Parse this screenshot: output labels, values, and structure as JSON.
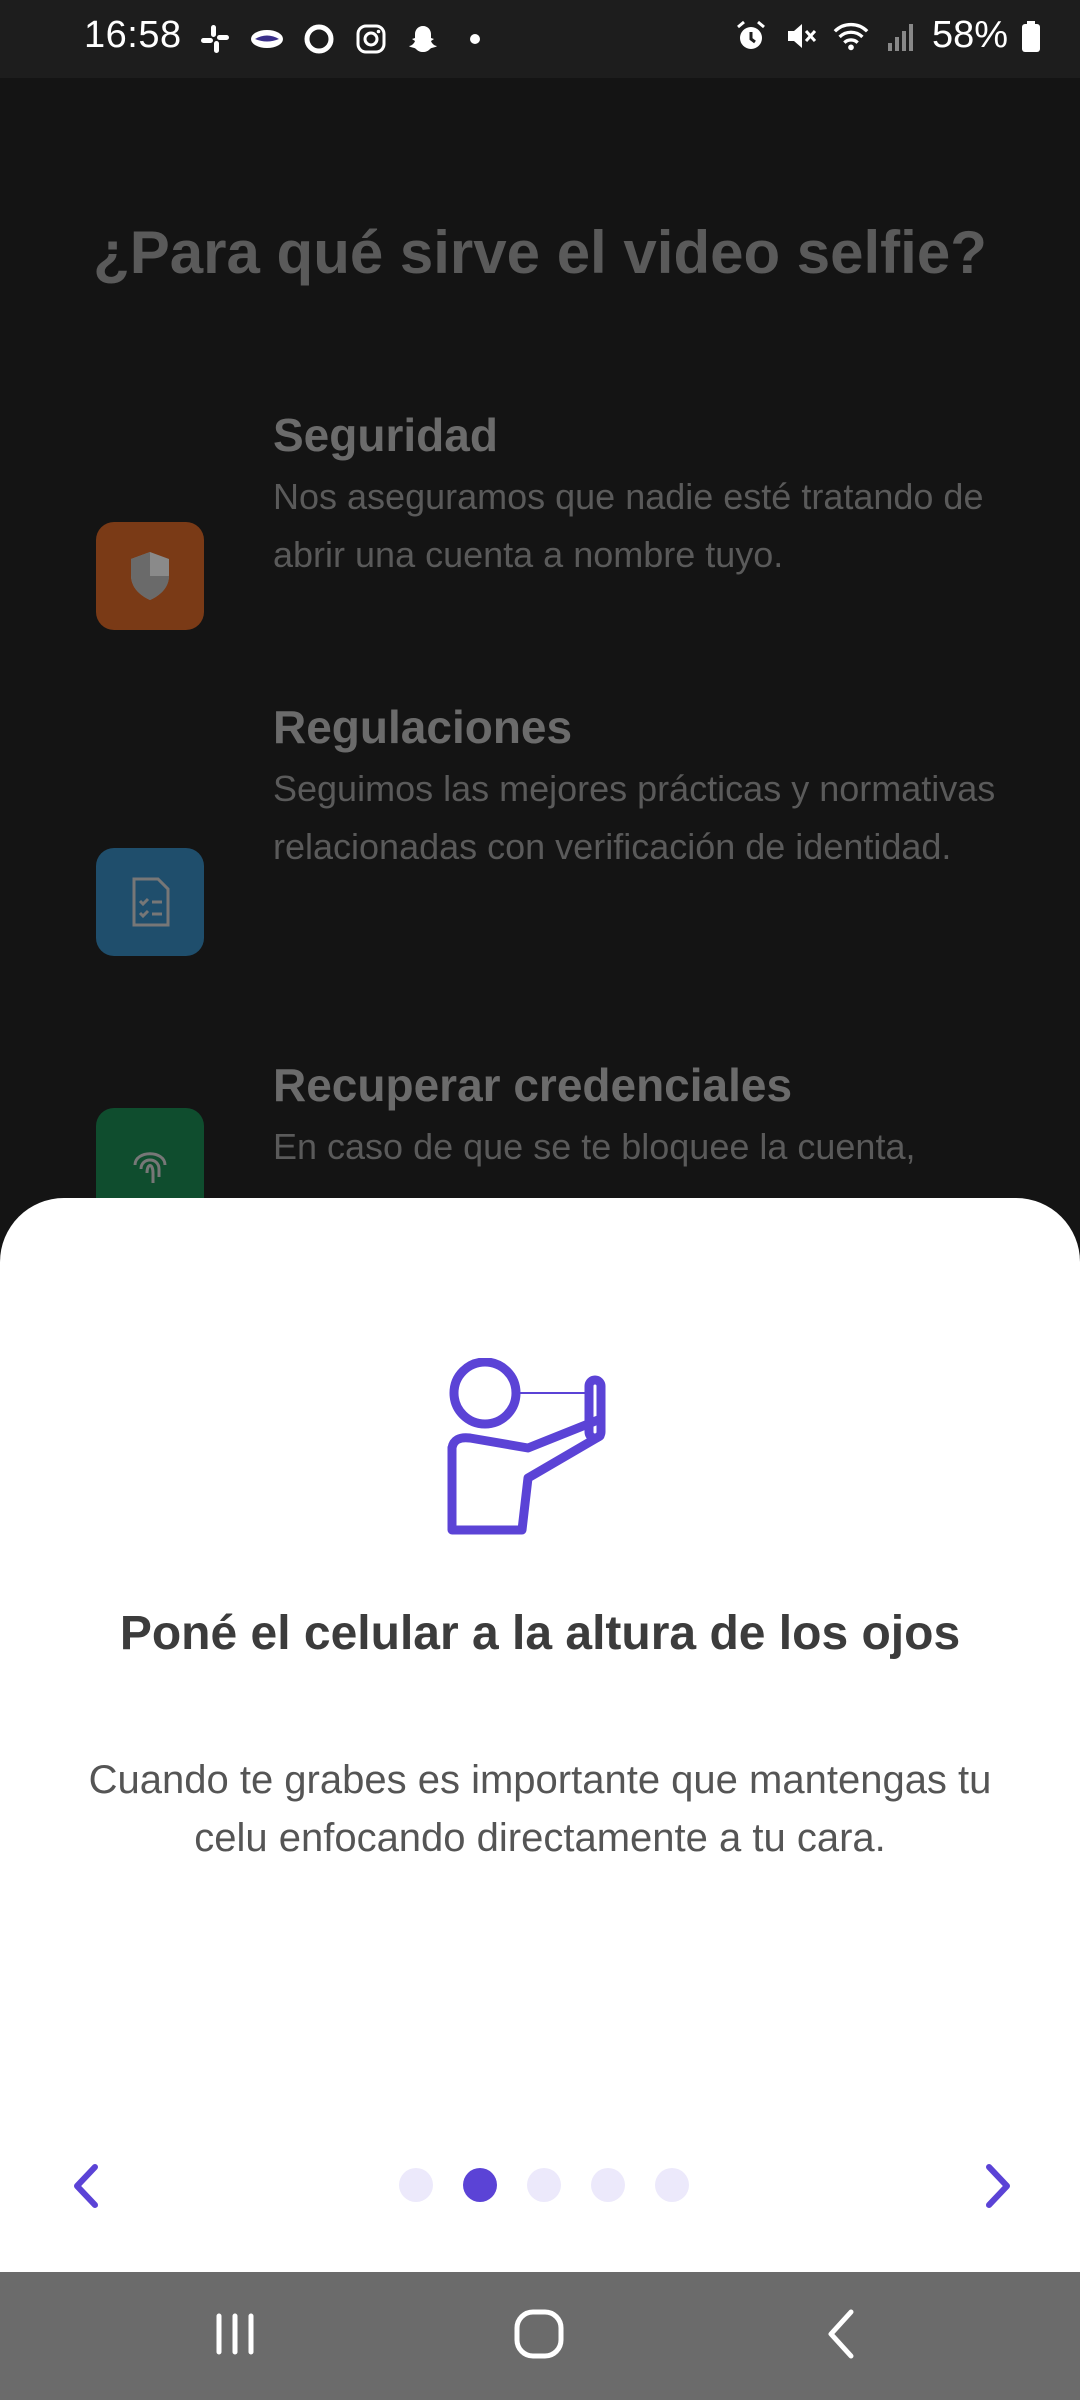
{
  "status_bar": {
    "time": "16:58",
    "battery": "58%",
    "left_icons": [
      "slack-icon",
      "handshake-icon",
      "circle-icon",
      "instagram-icon",
      "snapchat-icon",
      "dot-icon"
    ],
    "right_icons": [
      "alarm-icon",
      "mute-icon",
      "wifi-icon",
      "signal-icon",
      "battery-icon"
    ]
  },
  "background": {
    "title": "¿Para qué sirve el video selfie?",
    "features": [
      {
        "title": "Seguridad",
        "description": "Nos aseguramos que nadie esté tratando de abrir una cuenta a nombre tuyo.",
        "icon": "shield-icon",
        "color": "#ff6d1f"
      },
      {
        "title": "Regulaciones",
        "description": "Seguimos las mejores prácticas y normativas relacionadas con verificación de identidad.",
        "icon": "checklist-document-icon",
        "color": "#3b9ad6"
      },
      {
        "title": "Recuperar credenciales",
        "description": "En caso de que se te bloquee la cuenta,",
        "icon": "fingerprint-icon",
        "color": "#1fa362"
      }
    ]
  },
  "sheet": {
    "illustration": "person-holding-phone-icon",
    "title": "Poné el celular a la altura de los ojos",
    "body": "Cuando te grabes es importante que mantengas tu celu enfocando directamente a tu cara.",
    "prev_icon": "chevron-left-icon",
    "next_icon": "chevron-right-icon",
    "step_count": 5,
    "current_step": 2,
    "accent": "#5b43d6"
  },
  "android_nav": {
    "buttons": [
      "recents-icon",
      "home-icon",
      "back-icon"
    ]
  }
}
